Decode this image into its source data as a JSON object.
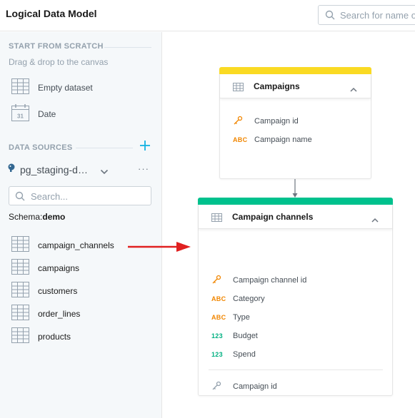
{
  "app": {
    "title": "Logical Data Model"
  },
  "top_search": {
    "placeholder": "Search for name o"
  },
  "sidebar": {
    "start_heading": "START FROM SCRATCH",
    "start_hint": "Drag & drop to the canvas",
    "scratch_items": [
      {
        "label": "Empty dataset",
        "icon": "table-grid-icon"
      },
      {
        "label": "Date",
        "icon": "calendar-icon"
      }
    ],
    "sources_heading": "DATA SOURCES",
    "data_source": {
      "name": "pg_staging-d…",
      "icon": "postgresql-icon"
    },
    "search_placeholder": "Search...",
    "schema_label": "Schema:",
    "schema_value": "demo",
    "tables": [
      "campaign_channels",
      "campaigns",
      "customers",
      "order_lines",
      "products"
    ]
  },
  "canvas": {
    "cards": [
      {
        "title": "Campaigns",
        "accent": "#fada23",
        "fields": [
          {
            "type": "key",
            "name": "Campaign id"
          },
          {
            "type": "ABC",
            "name": "Campaign name"
          }
        ]
      },
      {
        "title": "Campaign channels",
        "accent": "#00c18d",
        "fields": [
          {
            "type": "key",
            "name": "Campaign channel id"
          },
          {
            "type": "ABC",
            "name": "Category"
          },
          {
            "type": "ABC",
            "name": "Type"
          },
          {
            "type": "123",
            "name": "Budget"
          },
          {
            "type": "123",
            "name": "Spend"
          }
        ],
        "references": [
          {
            "type": "ref-key",
            "name": "Campaign id"
          }
        ]
      }
    ],
    "annotation_arrow_color": "#e02020"
  }
}
